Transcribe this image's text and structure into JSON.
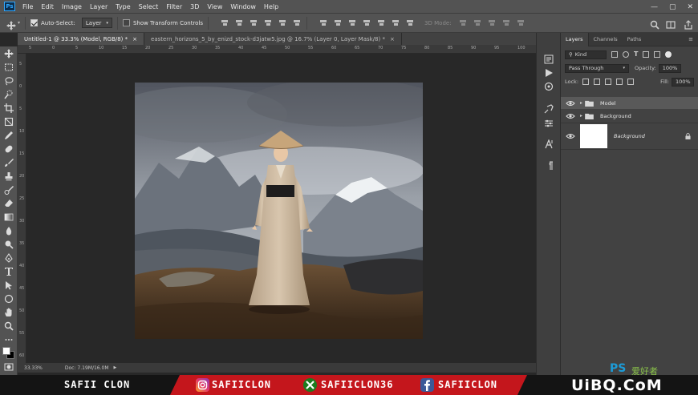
{
  "app": {
    "logo": "Ps"
  },
  "menu": [
    "File",
    "Edit",
    "Image",
    "Layer",
    "Type",
    "Select",
    "Filter",
    "3D",
    "View",
    "Window",
    "Help"
  ],
  "options_bar": {
    "auto_select_label": "Auto-Select:",
    "auto_select_value": "Layer",
    "show_transform_label": "Show Transform Controls",
    "mode_3d_label": "3D Mode:"
  },
  "tabs": [
    {
      "label": "Untitled-1 @ 33.3% (Model, RGB/8) *",
      "close": "×"
    },
    {
      "label": "eastern_horizons_5_by_enizd_stock-d3jatw5.jpg @ 16.7% (Layer 0, Layer Mask/8) *",
      "close": "×"
    }
  ],
  "rulers": {
    "top": [
      "5",
      "0",
      "5",
      "10",
      "15",
      "20",
      "25",
      "30",
      "35",
      "40",
      "45",
      "50",
      "55",
      "60",
      "65",
      "70",
      "75",
      "80",
      "85",
      "90",
      "95",
      "100"
    ],
    "left": [
      "5",
      "0",
      "5",
      "10",
      "15",
      "20",
      "25",
      "30",
      "35",
      "40",
      "45",
      "50",
      "55",
      "60"
    ]
  },
  "status": {
    "zoom": "33.33%",
    "doc": "Doc: 7.19M/16.0M"
  },
  "layers_panel": {
    "tabs": [
      "Layers",
      "Channels",
      "Paths"
    ],
    "filter_kind": "Kind",
    "blend_mode": "Pass Through",
    "opacity_label": "Opacity:",
    "opacity_value": "100%",
    "lock_label": "Lock:",
    "fill_label": "Fill:",
    "fill_value": "100%",
    "layers": [
      {
        "name": "Model",
        "type": "group",
        "selected": true
      },
      {
        "name": "Background",
        "type": "group",
        "selected": false
      },
      {
        "name": "Background",
        "type": "pixel",
        "locked": true,
        "selected": false
      }
    ]
  },
  "banner": {
    "name": "SAFII CLON",
    "instagram": "SAFIICLON",
    "xbox": "SAFIICLON36",
    "facebook": "SAFIICLON",
    "watermark": "UiBQ.CoM",
    "watermark_ps": "PS",
    "watermark_cn": "爱好者"
  },
  "colors": {
    "ps_blue": "#31a8ff",
    "banner_red": "#c4161c",
    "watermark_blue": "#1c9cd8"
  },
  "icons": [
    "move-icon",
    "marquee-icon",
    "lasso-icon",
    "quick-select-icon",
    "crop-icon",
    "eyedropper-icon",
    "healing-icon",
    "brush-icon",
    "clone-stamp-icon",
    "history-brush-icon",
    "eraser-icon",
    "gradient-icon",
    "blur-icon",
    "dodge-icon",
    "pen-icon",
    "type-icon",
    "path-select-icon",
    "shape-icon",
    "hand-icon",
    "zoom-icon"
  ]
}
